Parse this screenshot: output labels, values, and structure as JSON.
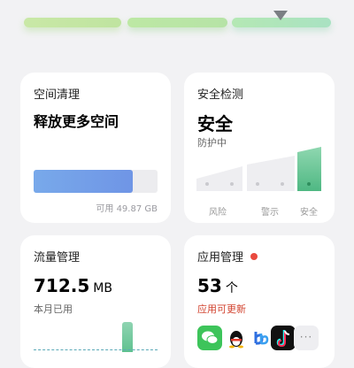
{
  "cards": {
    "storage": {
      "title": "空间清理",
      "headline": "释放更多空间",
      "available_label": "可用 49.87 GB",
      "used_fraction": 0.8
    },
    "security": {
      "title": "安全检测",
      "status": "安全",
      "subtitle": "防护中",
      "levels": [
        "风险",
        "警示",
        "安全"
      ],
      "active_level": "安全"
    },
    "traffic": {
      "title": "流量管理",
      "value": "712.5",
      "unit": "MB",
      "subtitle": "本月已用"
    },
    "apps": {
      "title": "应用管理",
      "count": "53",
      "count_unit": "个",
      "subtitle": "应用可更新",
      "icons": [
        "wechat-icon",
        "qq-icon",
        "app-icon",
        "tiktok-icon",
        "more-icon"
      ],
      "more_label": "···"
    }
  },
  "colors": {
    "accent_green": "#5fc190",
    "storage_bar": "#6f95e6",
    "alert_red": "#e94a3f"
  }
}
